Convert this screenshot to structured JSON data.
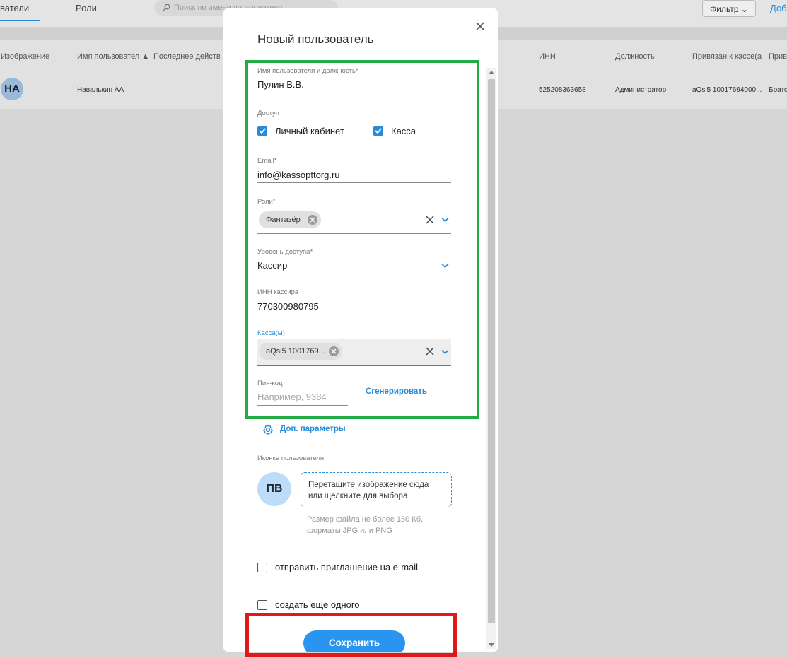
{
  "background_page": {
    "tabs": [
      "ватели",
      "Роли"
    ],
    "search_placeholder": "Поиск по имени пользователя",
    "filter_label": "Фильтр",
    "add_label": "Доб",
    "table": {
      "headers": [
        "Изображение",
        "Имя пользовател",
        "Последнее действ",
        "ИНН",
        "Должность",
        "Привязан к кассе(а",
        "Прив"
      ],
      "row": {
        "avatar": "НА",
        "name": "Навалькин АА",
        "inn": "525208363658",
        "position": "Администратор",
        "kassa": "aQsi5 10017694000...",
        "extra": "Брато"
      }
    }
  },
  "modal": {
    "title": "Новый пользователь",
    "username": {
      "label": "Имя пользователя и должность",
      "required": "*",
      "value": "Пулин В.В."
    },
    "access": {
      "label": "Доступ",
      "options": [
        {
          "label": "Личный кабинет",
          "checked": true
        },
        {
          "label": "Касса",
          "checked": true
        }
      ]
    },
    "email": {
      "label": "Email",
      "required": "*",
      "value": "info@kassopttorg.ru"
    },
    "roles": {
      "label": "Роли",
      "required": "*",
      "chip": "Фантазёр"
    },
    "access_level": {
      "label": "Уровень доступа",
      "required": "*",
      "value": "Кассир"
    },
    "cashier_inn": {
      "label": "ИНН кассира",
      "value": "770300980795"
    },
    "kassa": {
      "label": "Касса(ы)",
      "chip": "aQsi5 1001769..."
    },
    "pin": {
      "label": "Пин-код",
      "placeholder": "Например, 9384",
      "generate_label": "Сгенерировать"
    },
    "extra_params_label": "Доп. параметры",
    "user_icon": {
      "label": "Иконка пользователя",
      "initials": "ПВ",
      "drop_text": "Перетащите изображение сюда или щелкните для выбора",
      "hint": "Размер файла не более 150 Кб, форматы JPG или PNG"
    },
    "send_invite": {
      "label": "отправить приглашение на e-mail",
      "checked": false
    },
    "create_another": {
      "label": "создать еще одного",
      "checked": false
    },
    "save_label": "Сохранить"
  },
  "colors": {
    "accent": "#2a8ad6",
    "highlight_green": "#22aa44",
    "highlight_red": "#e01818"
  }
}
